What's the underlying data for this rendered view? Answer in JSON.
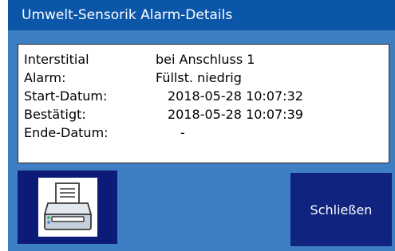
{
  "window": {
    "title": "Umwelt-Sensorik Alarm-Details"
  },
  "details": [
    {
      "label": "Interstitial",
      "value": "bei Anschluss 1"
    },
    {
      "label": "Alarm:",
      "value": "Füllst. niedrig"
    },
    {
      "label": "Start-Datum:",
      "value": "2018-05-28 10:07:32"
    },
    {
      "label": "Bestätigt:",
      "value": "2018-05-28 10:07:39"
    },
    {
      "label": "Ende-Datum:",
      "value": "-"
    }
  ],
  "buttons": {
    "print_icon": "printer-icon",
    "close_label": "Schließen"
  },
  "colors": {
    "title_bar": "#0b56a8",
    "window_background": "#3e7ec3",
    "button_background": "#10237e"
  }
}
